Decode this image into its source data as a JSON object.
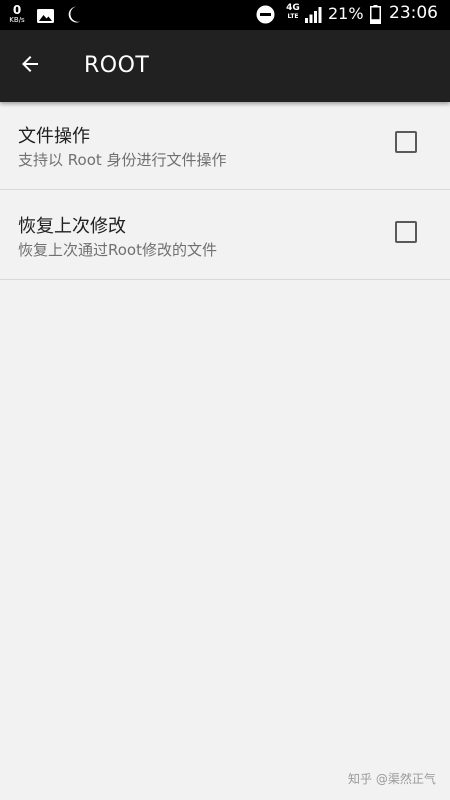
{
  "status_bar": {
    "net_speed_value": "0",
    "net_speed_unit": "KB/s",
    "network_type": "4G",
    "network_sub": "LTE",
    "battery": "21%",
    "time": "23:06",
    "icons": [
      "image-icon",
      "moon-icon",
      "do-not-disturb-icon",
      "signal-icon",
      "battery-icon"
    ]
  },
  "toolbar": {
    "title": "ROOT",
    "background": "#212121"
  },
  "settings": [
    {
      "title": "文件操作",
      "summary": "支持以 Root 身份进行文件操作",
      "checked": false
    },
    {
      "title": "恢复上次修改",
      "summary": "恢复上次通过Root修改的文件",
      "checked": false
    }
  ],
  "watermark": "知乎 @渠然正气"
}
